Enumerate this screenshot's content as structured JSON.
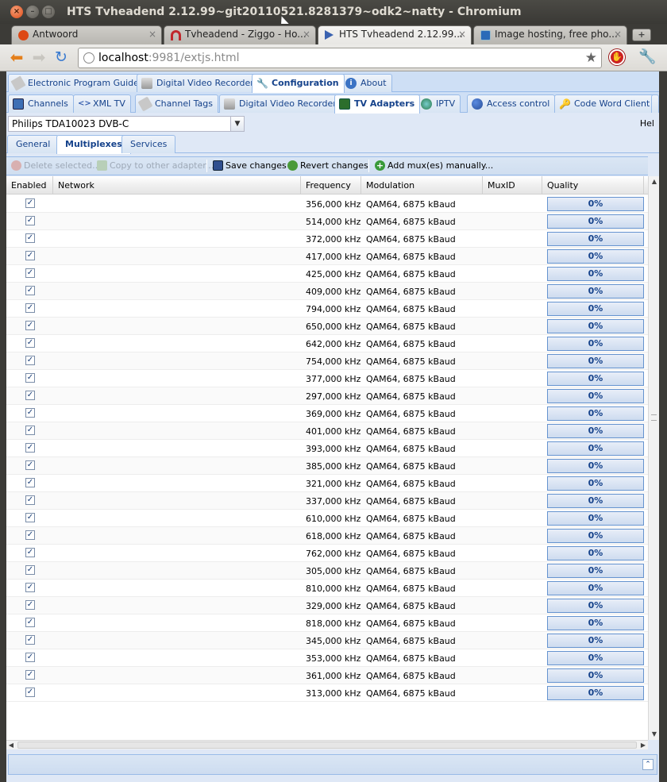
{
  "window": {
    "title": "HTS Tvheadend 2.12.99~git20110521.8281379~odk2~natty - Chromium"
  },
  "browser_tabs": [
    {
      "label": "Antwoord",
      "active": false
    },
    {
      "label": "Tvheadend - Ziggo - Ho...",
      "active": false
    },
    {
      "label": "HTS Tvheadend 2.12.99...",
      "active": true
    },
    {
      "label": "Image hosting, free pho...",
      "active": false
    }
  ],
  "address_bar": {
    "host": "localhost",
    "rest": ":9981/extjs.html"
  },
  "main_tabs": [
    {
      "label": "Electronic Program Guide",
      "icon": "tag-icon"
    },
    {
      "label": "Digital Video Recorder",
      "icon": "recorder-icon"
    },
    {
      "label": "Configuration",
      "icon": "wrench-icon",
      "active": true
    },
    {
      "label": "About",
      "icon": "info-icon"
    }
  ],
  "config_tabs": [
    {
      "label": "Channels",
      "icon": "tv-icon"
    },
    {
      "label": "XML TV",
      "icon": "code-icon"
    },
    {
      "label": "Channel Tags",
      "icon": "tag-icon"
    },
    {
      "label": "Digital Video Recorder",
      "icon": "recorder-icon"
    },
    {
      "label": "TV Adapters",
      "icon": "card-icon",
      "active": true
    },
    {
      "label": "IPTV",
      "icon": "globe-icon"
    },
    {
      "label": "Access control",
      "icon": "users-icon"
    },
    {
      "label": "Code Word Client",
      "icon": "key-icon"
    }
  ],
  "adapter": {
    "selected": "Philips TDA10023 DVB-C",
    "help": "Hel"
  },
  "adapter_tabs": [
    {
      "label": "General"
    },
    {
      "label": "Multiplexes",
      "active": true
    },
    {
      "label": "Services"
    }
  ],
  "grid_toolbar": {
    "delete": "Delete selected...",
    "copy": "Copy to other adapter...",
    "save": "Save changes",
    "revert": "Revert changes",
    "add": "Add mux(es) manually..."
  },
  "columns": [
    "Enabled",
    "Network",
    "Frequency",
    "Modulation",
    "MuxID",
    "Quality"
  ],
  "rows": [
    {
      "enabled": true,
      "network": "",
      "frequency": "356,000 kHz",
      "modulation": "QAM64, 6875 kBaud",
      "muxid": "",
      "quality": "0%"
    },
    {
      "enabled": true,
      "network": "",
      "frequency": "514,000 kHz",
      "modulation": "QAM64, 6875 kBaud",
      "muxid": "",
      "quality": "0%"
    },
    {
      "enabled": true,
      "network": "",
      "frequency": "372,000 kHz",
      "modulation": "QAM64, 6875 kBaud",
      "muxid": "",
      "quality": "0%"
    },
    {
      "enabled": true,
      "network": "",
      "frequency": "417,000 kHz",
      "modulation": "QAM64, 6875 kBaud",
      "muxid": "",
      "quality": "0%"
    },
    {
      "enabled": true,
      "network": "",
      "frequency": "425,000 kHz",
      "modulation": "QAM64, 6875 kBaud",
      "muxid": "",
      "quality": "0%"
    },
    {
      "enabled": true,
      "network": "",
      "frequency": "409,000 kHz",
      "modulation": "QAM64, 6875 kBaud",
      "muxid": "",
      "quality": "0%"
    },
    {
      "enabled": true,
      "network": "",
      "frequency": "794,000 kHz",
      "modulation": "QAM64, 6875 kBaud",
      "muxid": "",
      "quality": "0%"
    },
    {
      "enabled": true,
      "network": "",
      "frequency": "650,000 kHz",
      "modulation": "QAM64, 6875 kBaud",
      "muxid": "",
      "quality": "0%"
    },
    {
      "enabled": true,
      "network": "",
      "frequency": "642,000 kHz",
      "modulation": "QAM64, 6875 kBaud",
      "muxid": "",
      "quality": "0%"
    },
    {
      "enabled": true,
      "network": "",
      "frequency": "754,000 kHz",
      "modulation": "QAM64, 6875 kBaud",
      "muxid": "",
      "quality": "0%"
    },
    {
      "enabled": true,
      "network": "",
      "frequency": "377,000 kHz",
      "modulation": "QAM64, 6875 kBaud",
      "muxid": "",
      "quality": "0%"
    },
    {
      "enabled": true,
      "network": "",
      "frequency": "297,000 kHz",
      "modulation": "QAM64, 6875 kBaud",
      "muxid": "",
      "quality": "0%"
    },
    {
      "enabled": true,
      "network": "",
      "frequency": "369,000 kHz",
      "modulation": "QAM64, 6875 kBaud",
      "muxid": "",
      "quality": "0%"
    },
    {
      "enabled": true,
      "network": "",
      "frequency": "401,000 kHz",
      "modulation": "QAM64, 6875 kBaud",
      "muxid": "",
      "quality": "0%"
    },
    {
      "enabled": true,
      "network": "",
      "frequency": "393,000 kHz",
      "modulation": "QAM64, 6875 kBaud",
      "muxid": "",
      "quality": "0%"
    },
    {
      "enabled": true,
      "network": "",
      "frequency": "385,000 kHz",
      "modulation": "QAM64, 6875 kBaud",
      "muxid": "",
      "quality": "0%"
    },
    {
      "enabled": true,
      "network": "",
      "frequency": "321,000 kHz",
      "modulation": "QAM64, 6875 kBaud",
      "muxid": "",
      "quality": "0%"
    },
    {
      "enabled": true,
      "network": "",
      "frequency": "337,000 kHz",
      "modulation": "QAM64, 6875 kBaud",
      "muxid": "",
      "quality": "0%"
    },
    {
      "enabled": true,
      "network": "",
      "frequency": "610,000 kHz",
      "modulation": "QAM64, 6875 kBaud",
      "muxid": "",
      "quality": "0%"
    },
    {
      "enabled": true,
      "network": "",
      "frequency": "618,000 kHz",
      "modulation": "QAM64, 6875 kBaud",
      "muxid": "",
      "quality": "0%"
    },
    {
      "enabled": true,
      "network": "",
      "frequency": "762,000 kHz",
      "modulation": "QAM64, 6875 kBaud",
      "muxid": "",
      "quality": "0%"
    },
    {
      "enabled": true,
      "network": "",
      "frequency": "305,000 kHz",
      "modulation": "QAM64, 6875 kBaud",
      "muxid": "",
      "quality": "0%"
    },
    {
      "enabled": true,
      "network": "",
      "frequency": "810,000 kHz",
      "modulation": "QAM64, 6875 kBaud",
      "muxid": "",
      "quality": "0%"
    },
    {
      "enabled": true,
      "network": "",
      "frequency": "329,000 kHz",
      "modulation": "QAM64, 6875 kBaud",
      "muxid": "",
      "quality": "0%"
    },
    {
      "enabled": true,
      "network": "",
      "frequency": "818,000 kHz",
      "modulation": "QAM64, 6875 kBaud",
      "muxid": "",
      "quality": "0%"
    },
    {
      "enabled": true,
      "network": "",
      "frequency": "345,000 kHz",
      "modulation": "QAM64, 6875 kBaud",
      "muxid": "",
      "quality": "0%"
    },
    {
      "enabled": true,
      "network": "",
      "frequency": "353,000 kHz",
      "modulation": "QAM64, 6875 kBaud",
      "muxid": "",
      "quality": "0%"
    },
    {
      "enabled": true,
      "network": "",
      "frequency": "361,000 kHz",
      "modulation": "QAM64, 6875 kBaud",
      "muxid": "",
      "quality": "0%"
    },
    {
      "enabled": true,
      "network": "",
      "frequency": "313,000 kHz",
      "modulation": "QAM64, 6875 kBaud",
      "muxid": "",
      "quality": "0%"
    }
  ],
  "colors": {
    "ext_blue": "#15428b",
    "panel_bg": "#dfe8f6",
    "border": "#99bbe8",
    "ubuntu_orange": "#df4a16"
  }
}
